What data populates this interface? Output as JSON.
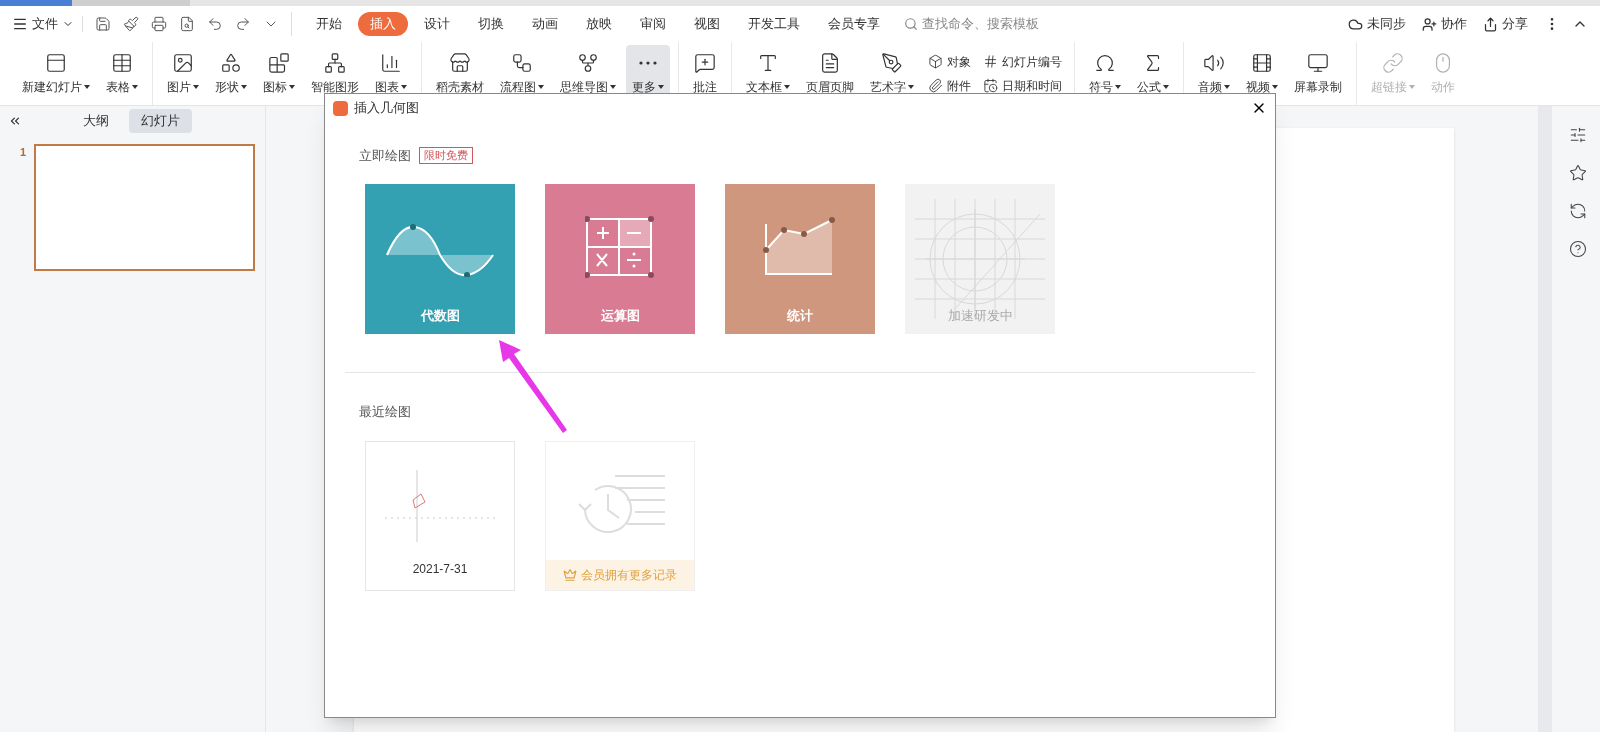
{
  "menu": {
    "file_label": "文件",
    "tabs": [
      {
        "label": "开始",
        "selected": false
      },
      {
        "label": "插入",
        "selected": true
      },
      {
        "label": "设计",
        "selected": false
      },
      {
        "label": "切换",
        "selected": false
      },
      {
        "label": "动画",
        "selected": false
      },
      {
        "label": "放映",
        "selected": false
      },
      {
        "label": "审阅",
        "selected": false
      },
      {
        "label": "视图",
        "selected": false
      },
      {
        "label": "开发工具",
        "selected": false
      },
      {
        "label": "会员专享",
        "selected": false
      }
    ],
    "search_placeholder": "查找命令、搜索模板",
    "right_actions": [
      "未同步",
      "协作",
      "分享"
    ]
  },
  "ribbon": {
    "groups": [
      [
        {
          "kind": "large",
          "label": "新建幻灯片",
          "dropdown": true,
          "disabled": false,
          "selected": false
        },
        {
          "kind": "large",
          "label": "表格",
          "dropdown": true,
          "disabled": false,
          "selected": false
        }
      ],
      [
        {
          "kind": "large",
          "label": "图片",
          "dropdown": true,
          "disabled": false,
          "selected": false
        },
        {
          "kind": "large",
          "label": "形状",
          "dropdown": true,
          "disabled": false,
          "selected": false
        },
        {
          "kind": "large",
          "label": "图标",
          "dropdown": true,
          "disabled": false,
          "selected": false
        },
        {
          "kind": "large",
          "label": "智能图形",
          "dropdown": false,
          "disabled": false,
          "selected": false
        },
        {
          "kind": "large",
          "label": "图表",
          "dropdown": true,
          "disabled": false,
          "selected": false
        }
      ],
      [
        {
          "kind": "large",
          "label": "稻壳素材",
          "dropdown": false,
          "disabled": false,
          "selected": false
        },
        {
          "kind": "large",
          "label": "流程图",
          "dropdown": true,
          "disabled": false,
          "selected": false
        },
        {
          "kind": "large",
          "label": "思维导图",
          "dropdown": true,
          "disabled": false,
          "selected": false
        },
        {
          "kind": "large",
          "label": "更多",
          "dropdown": true,
          "disabled": false,
          "selected": true
        }
      ],
      [
        {
          "kind": "large",
          "label": "批注",
          "dropdown": false,
          "disabled": false,
          "selected": false
        }
      ],
      [
        {
          "kind": "large",
          "label": "文本框",
          "dropdown": true,
          "disabled": false,
          "selected": false
        },
        {
          "kind": "large",
          "label": "页眉页脚",
          "dropdown": false,
          "disabled": false,
          "selected": false
        },
        {
          "kind": "large",
          "label": "艺术字",
          "dropdown": true,
          "disabled": false,
          "selected": false
        },
        {
          "kind": "pair",
          "labels": [
            "对象",
            "附件"
          ]
        },
        {
          "kind": "pair",
          "labels": [
            "幻灯片编号",
            "日期和时间"
          ]
        }
      ],
      [
        {
          "kind": "large",
          "label": "符号",
          "dropdown": true,
          "disabled": false,
          "selected": false
        },
        {
          "kind": "large",
          "label": "公式",
          "dropdown": true,
          "disabled": false,
          "selected": false
        }
      ],
      [
        {
          "kind": "large",
          "label": "音频",
          "dropdown": true,
          "disabled": false,
          "selected": false
        },
        {
          "kind": "large",
          "label": "视频",
          "dropdown": true,
          "disabled": false,
          "selected": false
        },
        {
          "kind": "large",
          "label": "屏幕录制",
          "dropdown": false,
          "disabled": false,
          "selected": false
        }
      ],
      [
        {
          "kind": "large",
          "label": "超链接",
          "dropdown": true,
          "disabled": true,
          "selected": false
        },
        {
          "kind": "large",
          "label": "动作",
          "dropdown": false,
          "disabled": true,
          "selected": false
        }
      ]
    ]
  },
  "left_panel": {
    "tabs": [
      {
        "label": "大纲",
        "selected": false
      },
      {
        "label": "幻灯片",
        "selected": true
      }
    ],
    "slides": [
      {
        "number": "1",
        "selected": true
      }
    ]
  },
  "dialog": {
    "title": "插入几何图",
    "instant": {
      "title": "立即绘图",
      "badge": "限时免费",
      "cards": [
        {
          "kind": "algebra",
          "label": "代数图",
          "color": "#33a1b2",
          "disabled": false
        },
        {
          "kind": "arithmetic",
          "label": "运算图",
          "color": "#d97b93",
          "disabled": false
        },
        {
          "kind": "statistics",
          "label": "统计",
          "color": "#cf977e",
          "disabled": false
        },
        {
          "kind": "geometry",
          "label": "加速研发中",
          "color": "#f2f2f2",
          "disabled": true
        }
      ]
    },
    "recent": {
      "title": "最近绘图",
      "items": [
        {
          "kind": "drawing",
          "caption": "2021-7-31"
        },
        {
          "kind": "member",
          "caption": "会员拥有更多记录"
        }
      ]
    }
  }
}
